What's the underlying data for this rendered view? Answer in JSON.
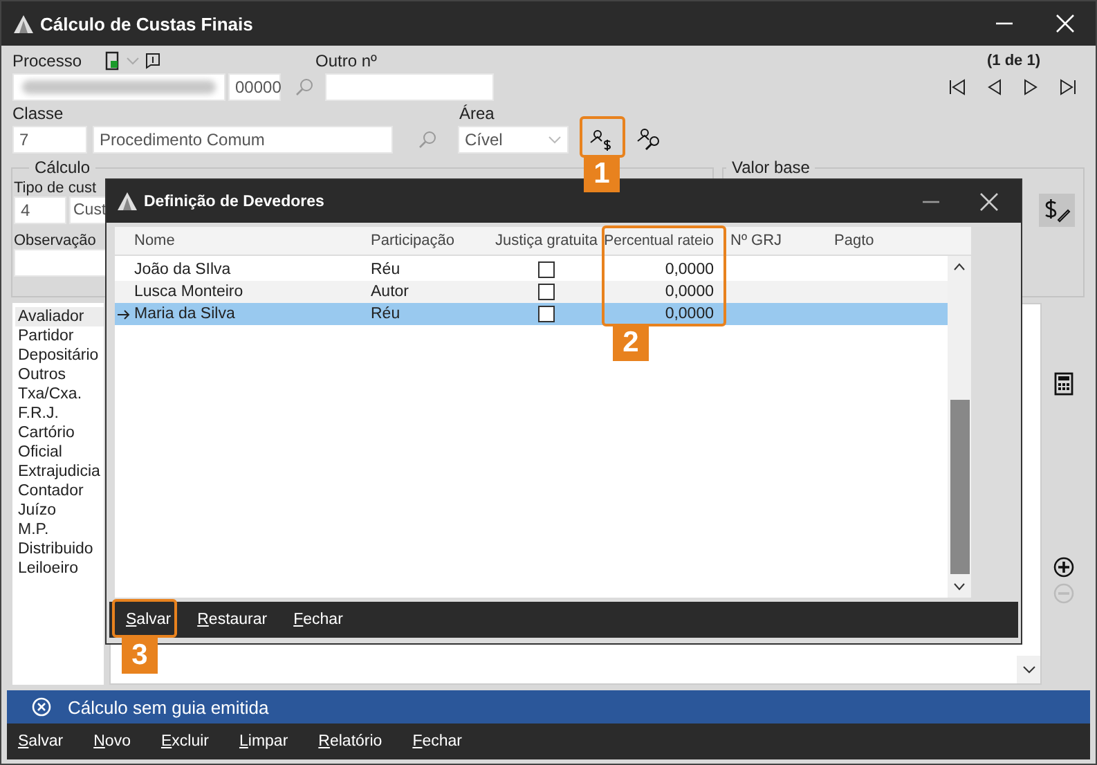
{
  "window": {
    "title": "Cálculo de Custas Finais"
  },
  "processo": {
    "label": "Processo",
    "number": "00000"
  },
  "outro": {
    "label": "Outro nº"
  },
  "pager": {
    "count": "(1 de 1)"
  },
  "classe": {
    "label": "Classe",
    "code": "7",
    "name": "Procedimento Comum"
  },
  "area": {
    "label": "Área",
    "value": "Cível"
  },
  "calculo": {
    "title": "Cálculo",
    "tipo_label": "Tipo de cust",
    "tipo_code": "4",
    "tipo_name": "Cust",
    "observacao_label": "Observação"
  },
  "valor_base": {
    "title": "Valor base"
  },
  "left_list": [
    {
      "label": "Avaliador",
      "selected": true
    },
    {
      "label": "Partidor",
      "selected": false
    },
    {
      "label": "Depositário",
      "selected": false
    },
    {
      "label": "Outros",
      "selected": false
    },
    {
      "label": "Txa/Cxa.",
      "selected": false
    },
    {
      "label": "F.R.J.",
      "selected": false
    },
    {
      "label": "Cartório",
      "selected": false
    },
    {
      "label": "Oficial",
      "selected": false
    },
    {
      "label": "Extrajudicia",
      "selected": false
    },
    {
      "label": "Contador",
      "selected": false
    },
    {
      "label": "Juízo",
      "selected": false
    },
    {
      "label": "M.P.",
      "selected": false
    },
    {
      "label": "Distribuido",
      "selected": false
    },
    {
      "label": "Leiloeiro",
      "selected": false
    }
  ],
  "dialog": {
    "title": "Definição de Devedores",
    "columns": [
      "Nome",
      "Participação",
      "Justiça gratuita",
      "Percentual rateio",
      "Nº GRJ",
      "Pagto"
    ],
    "rows": [
      {
        "nome": "João da SIlva",
        "participacao": "Réu",
        "justica_gratuita": false,
        "percentual": "0,0000",
        "selected": false
      },
      {
        "nome": "Lusca Monteiro",
        "participacao": "Autor",
        "justica_gratuita": false,
        "percentual": "0,0000",
        "selected": false
      },
      {
        "nome": "Maria da Silva",
        "participacao": "Réu",
        "justica_gratuita": false,
        "percentual": "0,0000",
        "selected": true
      }
    ],
    "buttons": [
      "Salvar",
      "Restaurar",
      "Fechar"
    ]
  },
  "annotations": [
    "1",
    "2",
    "3"
  ],
  "status": {
    "message": "Cálculo sem guia emitida"
  },
  "toolbar": [
    "Salvar",
    "Novo",
    "Excluir",
    "Limpar",
    "Relatório",
    "Fechar"
  ]
}
